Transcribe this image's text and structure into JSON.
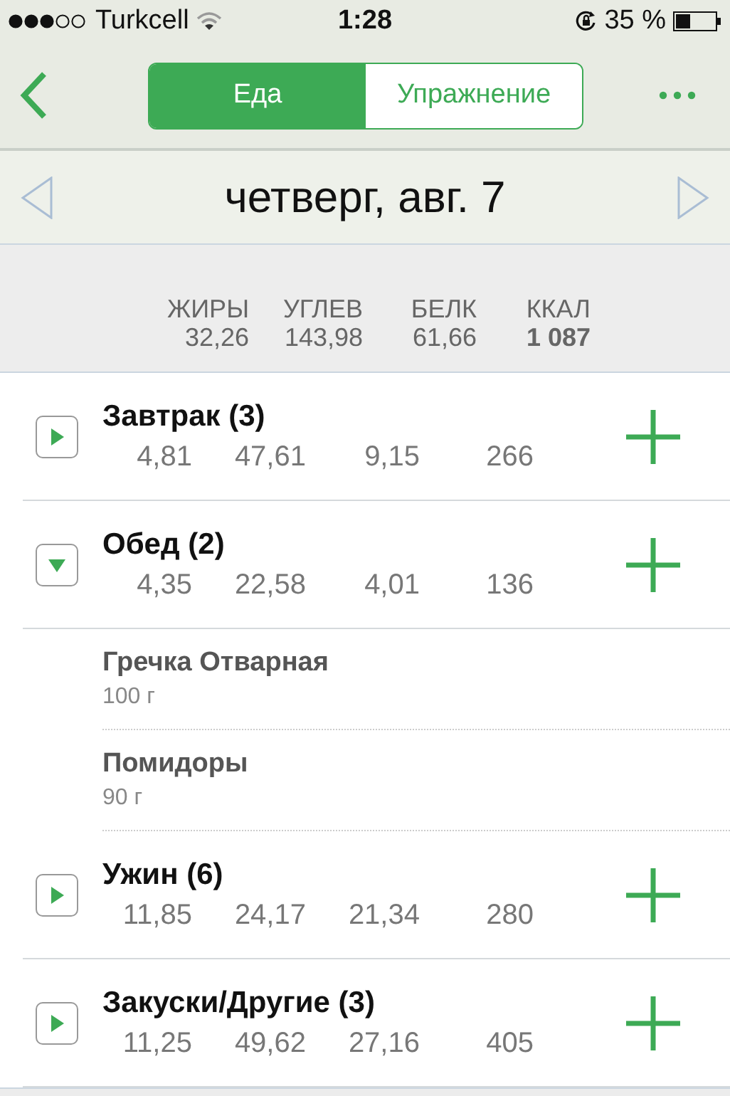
{
  "status_bar": {
    "carrier": "Turkcell",
    "time": "1:28",
    "battery": "35 %"
  },
  "nav": {
    "tabs": [
      {
        "label": "Еда",
        "selected": true
      },
      {
        "label": "Упражнение",
        "selected": false
      }
    ]
  },
  "date_bar": {
    "date": "четверг, авг. 7"
  },
  "totals": [
    {
      "label": "ЖИРЫ",
      "value": "32,26",
      "bold": false
    },
    {
      "label": "УГЛЕВ",
      "value": "143,98",
      "bold": false
    },
    {
      "label": "БЕЛК",
      "value": "61,66",
      "bold": false
    },
    {
      "label": "ККАЛ",
      "value": "1 087",
      "bold": true
    }
  ],
  "meals": [
    {
      "name": "Завтрак (3)",
      "values": [
        "4,81",
        "47,61",
        "9,15",
        "266"
      ],
      "expanded": false
    },
    {
      "name": "Обед (2)",
      "values": [
        "4,35",
        "22,58",
        "4,01",
        "136"
      ],
      "expanded": true,
      "items": [
        {
          "name": "Гречка Отварная",
          "amount": "100 г"
        },
        {
          "name": "Помидоры",
          "amount": "90 г"
        }
      ]
    },
    {
      "name": "Ужин (6)",
      "values": [
        "11,85",
        "24,17",
        "21,34",
        "280"
      ],
      "expanded": false
    },
    {
      "name": "Закуски/Другие (3)",
      "values": [
        "11,25",
        "49,62",
        "27,16",
        "405"
      ],
      "expanded": false
    }
  ]
}
